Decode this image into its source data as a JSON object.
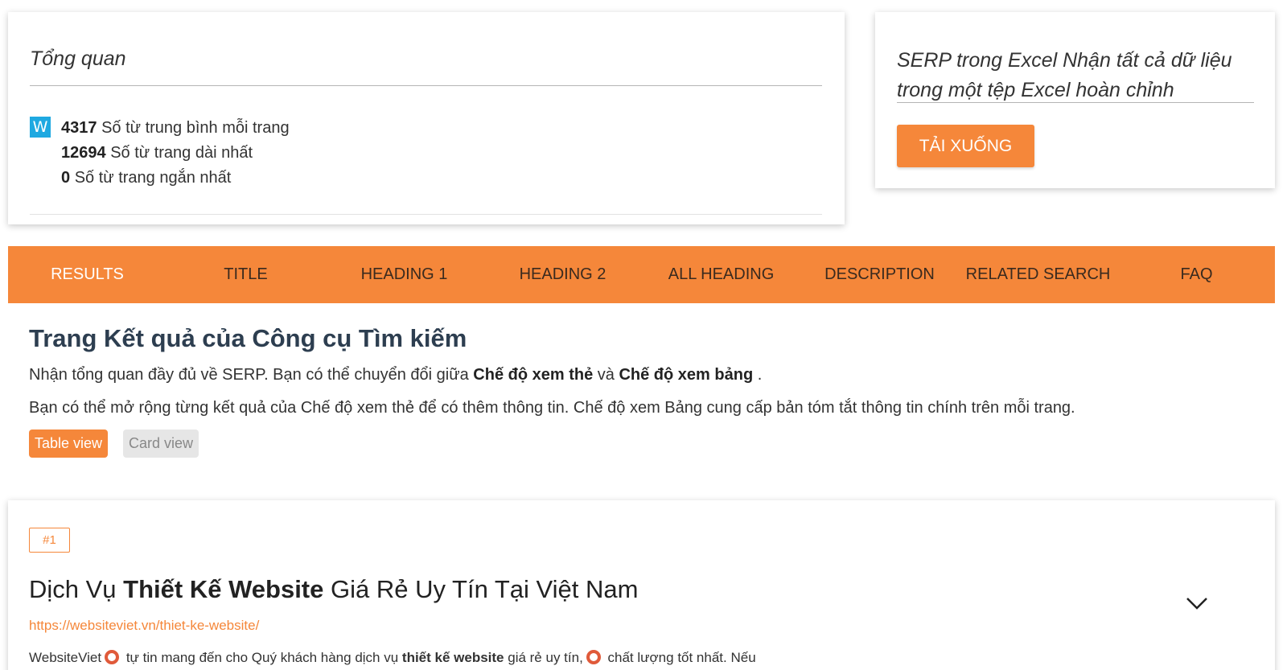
{
  "overview": {
    "title": "Tổng quan",
    "icon_letter": "W",
    "stats": [
      {
        "value": "4317",
        "label": "Số từ trung bình mỗi trang"
      },
      {
        "value": "12694",
        "label": "Số từ trang dài nhất"
      },
      {
        "value": "0",
        "label": "Số từ trang ngắn nhất"
      }
    ]
  },
  "download": {
    "title": "SERP trong Excel Nhận tất cả dữ liệu trong một tệp Excel hoàn chỉnh",
    "button_label": "TẢI XUỐNG"
  },
  "tabs": [
    {
      "label": "RESULTS",
      "active": true
    },
    {
      "label": "TITLE",
      "active": false
    },
    {
      "label": "HEADING 1",
      "active": false
    },
    {
      "label": "HEADING 2",
      "active": false
    },
    {
      "label": "ALL HEADING",
      "active": false
    },
    {
      "label": "DESCRIPTION",
      "active": false
    },
    {
      "label": "RELATED SEARCH",
      "active": false
    },
    {
      "label": "FAQ",
      "active": false
    }
  ],
  "section": {
    "heading": "Trang Kết quả của Công cụ Tìm kiếm",
    "intro_prefix": "Nhận tổng quan đầy đủ về SERP. Bạn có thể chuyển đổi giữa ",
    "intro_bold1": "Chế độ xem thẻ",
    "intro_mid": " và ",
    "intro_bold2": "Chế độ xem bảng",
    "intro_suffix": " .",
    "description": "Bạn có thể mở rộng từng kết quả của Chế độ xem thẻ để có thêm thông tin. Chế độ xem Bảng cung cấp bản tóm tắt thông tin chính trên mỗi trang.",
    "table_view_label": "Table view",
    "card_view_label": "Card view"
  },
  "result": {
    "rank": "#1",
    "title_prefix": "Dịch Vụ ",
    "title_bold": "Thiết Kế Website",
    "title_suffix": " Giá Rẻ Uy Tín Tại Việt Nam",
    "url": "https://websiteviet.vn/thiet-ke-website/",
    "snippet_a": "WebsiteViet",
    "snippet_b": " tự tin mang đến cho Quý khách hàng dịch vụ ",
    "snippet_bold": "thiết kế website",
    "snippet_c": " giá rẻ uy tín,",
    "snippet_d": " chất lượng tốt nhất. Nếu"
  },
  "colors": {
    "accent": "#f5873a",
    "heading": "#2d3e50",
    "icon_blue": "#1fa9e1"
  },
  "icons": [
    "w-icon",
    "circle-emoji-icon",
    "chevron-down-icon"
  ]
}
